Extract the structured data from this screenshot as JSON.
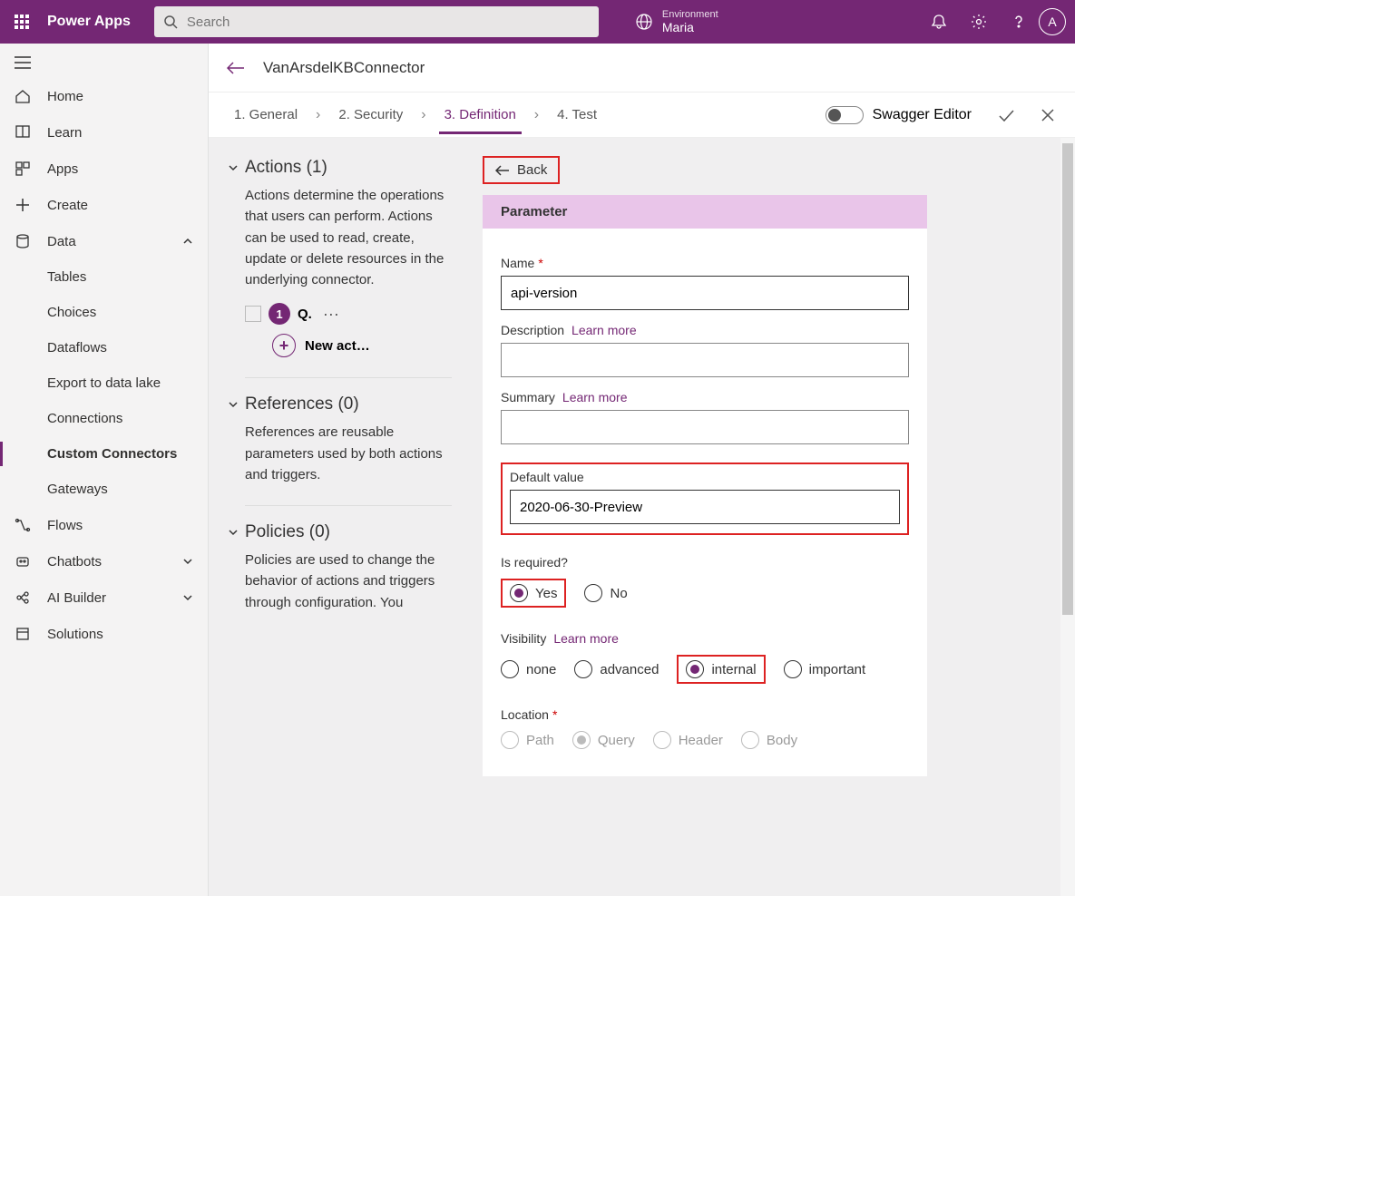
{
  "header": {
    "brand": "Power Apps",
    "search_placeholder": "Search",
    "env_label": "Environment",
    "env_value": "Maria",
    "avatar_initial": "A"
  },
  "sidenav": {
    "home": "Home",
    "learn": "Learn",
    "apps": "Apps",
    "create": "Create",
    "data": "Data",
    "tables": "Tables",
    "choices": "Choices",
    "dataflows": "Dataflows",
    "export": "Export to data lake",
    "connections": "Connections",
    "custom": "Custom Connectors",
    "gateways": "Gateways",
    "flows": "Flows",
    "chatbots": "Chatbots",
    "ai": "AI Builder",
    "solutions": "Solutions"
  },
  "page": {
    "title": "VanArsdelKBConnector",
    "swagger_label": "Swagger Editor"
  },
  "steps": {
    "s1": "1. General",
    "s2": "2. Security",
    "s3": "3. Definition",
    "s4": "4. Test"
  },
  "actions": {
    "header": "Actions (1)",
    "desc": "Actions determine the operations that users can perform. Actions can be used to read, create, update or delete resources in the underlying connector.",
    "badge": "1",
    "q": "Q.",
    "new_label": "New act…",
    "refs_header": "References (0)",
    "refs_desc": "References are reusable parameters used by both actions and triggers.",
    "pol_header": "Policies (0)",
    "pol_desc": "Policies are used to change the behavior of actions and triggers through configuration. You"
  },
  "form": {
    "back": "Back",
    "strip": "Parameter",
    "name_label": "Name",
    "name_value": "api-version",
    "desc_label": "Description",
    "learn": "Learn more",
    "summary_label": "Summary",
    "default_label": "Default value",
    "default_value": "2020-06-30-Preview",
    "isreq_label": "Is required?",
    "yes": "Yes",
    "no": "No",
    "vis_label": "Visibility",
    "v_none": "none",
    "v_adv": "advanced",
    "v_int": "internal",
    "v_imp": "important",
    "loc_label": "Location",
    "l_path": "Path",
    "l_query": "Query",
    "l_header": "Header",
    "l_body": "Body"
  }
}
